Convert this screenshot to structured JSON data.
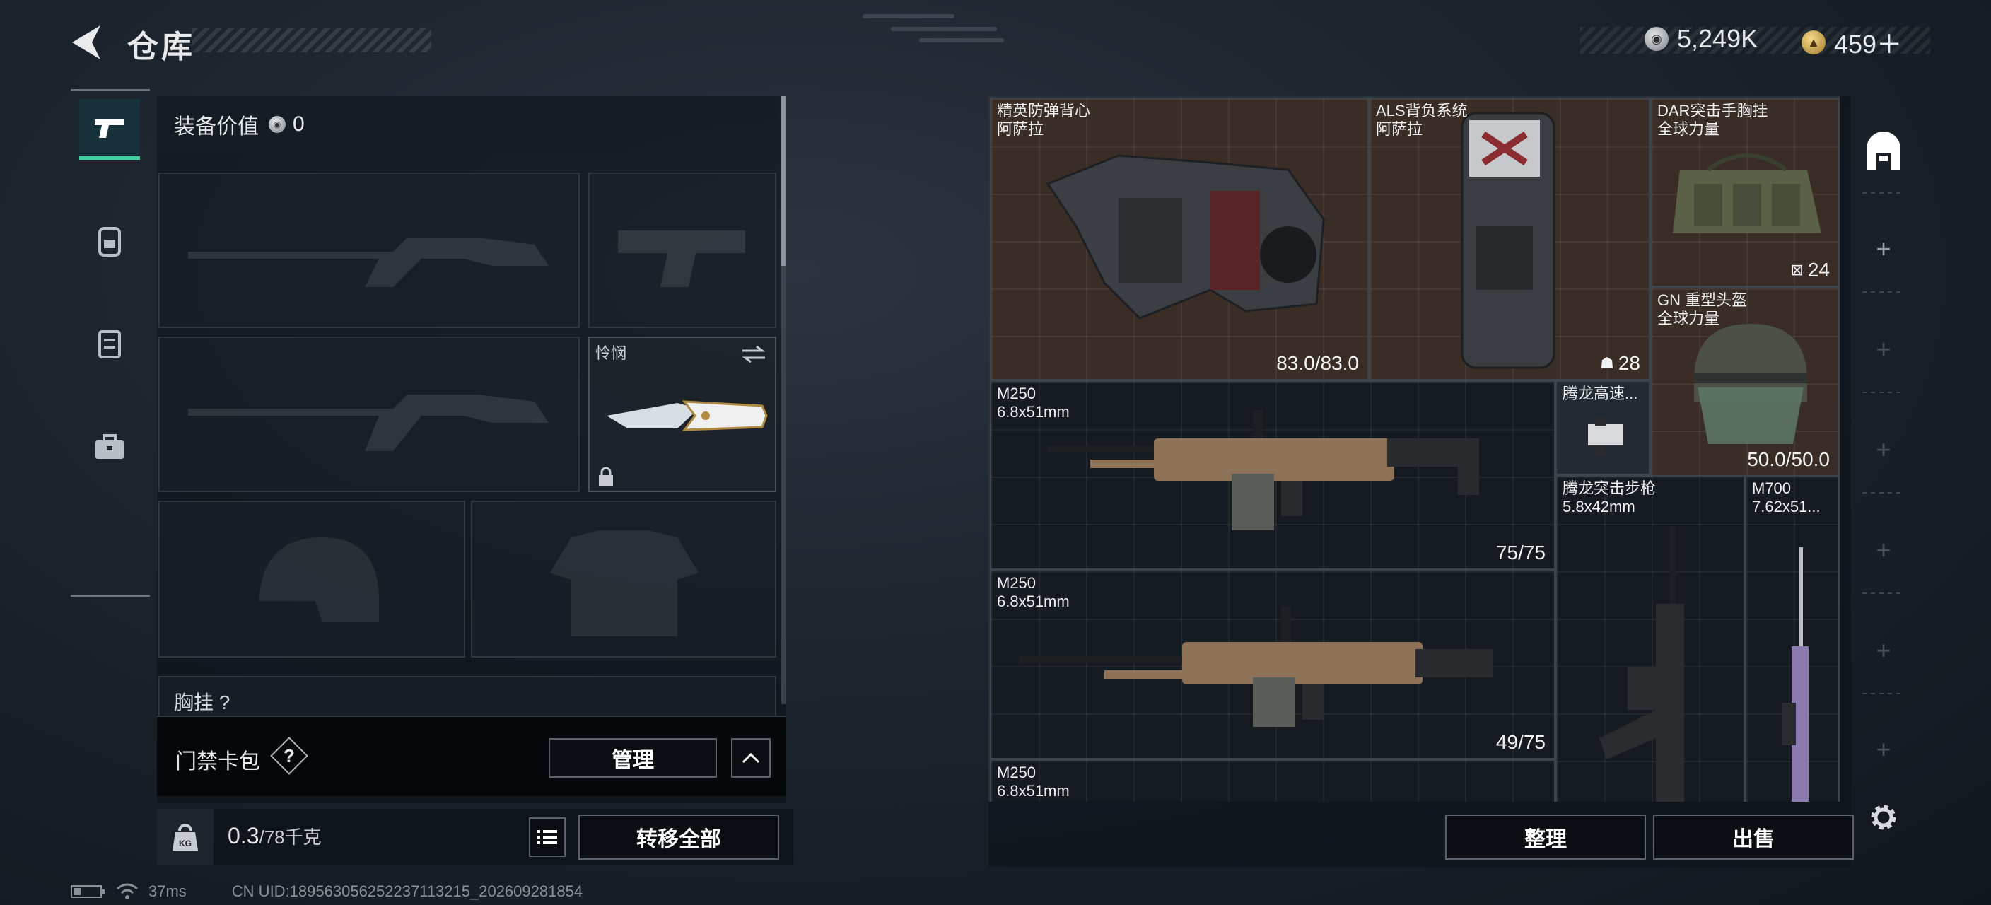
{
  "header": {
    "title": "仓库",
    "currency_silver": "5,249K",
    "currency_gold": "459＋"
  },
  "nav": {
    "items": [
      "pistol-icon",
      "backpack-icon",
      "vest-icon",
      "briefcase-icon"
    ],
    "active": 0
  },
  "equipment": {
    "value_label": "装备价值",
    "value": "0",
    "melee_label": "怜悯",
    "chest_rig_label": "胸挂",
    "chest_rig_value": "?"
  },
  "keycard": {
    "label": "门禁卡包",
    "help": "?",
    "manage_label": "管理"
  },
  "carry": {
    "weight_value": "0.3",
    "weight_max": "/78千克",
    "transfer_all_label": "转移全部"
  },
  "status": {
    "ping": "37ms",
    "uid": "CN UID:18956305625223711321​5_202609281854"
  },
  "storage": {
    "items": [
      {
        "name": "精英防弹背心",
        "sub": "阿萨拉",
        "value": "83.0/83.0"
      },
      {
        "name": "ALS背负系统",
        "sub": "阿萨拉",
        "value": "28"
      },
      {
        "name": "DAR突击手胸挂",
        "sub": "全球力量",
        "value": "24"
      },
      {
        "name": "GN 重型头盔",
        "sub": "全球力量",
        "value": "50.0/50.0"
      },
      {
        "name": "M250",
        "sub": "6.8x51mm",
        "value": "75/75"
      },
      {
        "name": "腾龙高速...",
        "sub": "",
        "value": ""
      },
      {
        "name": "M250",
        "sub": "6.8x51mm",
        "value": "49/75"
      },
      {
        "name": "腾龙突击步枪",
        "sub": "5.8x42mm",
        "value": ""
      },
      {
        "name": "M700",
        "sub": "7.62x51...",
        "value": ""
      },
      {
        "name": "M250",
        "sub": "6.8x51mm",
        "value": ""
      }
    ],
    "sort_label": "整理",
    "sell_label": "出售"
  },
  "colors": {
    "accent": "#3fd29c",
    "item_highlight": "#3a2d26",
    "panel": "#161b21"
  }
}
